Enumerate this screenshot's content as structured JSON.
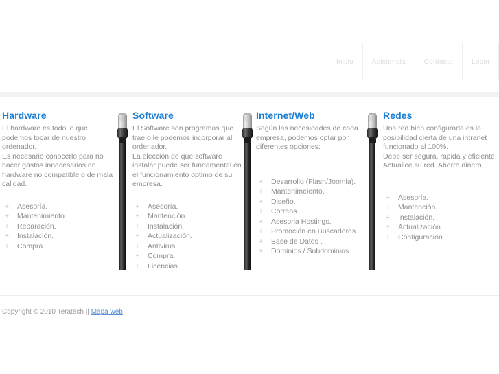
{
  "nav": {
    "items": [
      {
        "label": "Inicio"
      },
      {
        "label": "Asistencia"
      },
      {
        "label": "Contacto"
      },
      {
        "label": "Login"
      }
    ]
  },
  "colors": {
    "heading": "#1a7fd4",
    "body_text": "#8f8f8f",
    "nav_text": "#dcdcdc",
    "link": "#5a8fd6",
    "band": "#f2f2f2"
  },
  "columns": [
    {
      "title": "Hardware",
      "description": "El hardware es todo lo que podemos tocar de nuestro ordenador.\nEs necesario conocerlo para no hacer gastos innecesarios en hardware no compatible o de mala calidad.",
      "items": [
        "Asesoría.",
        "Mantenimiento.",
        "Reparación.",
        "Instalación.",
        "Compra."
      ]
    },
    {
      "title": "Software",
      "description": "El Software son programas que trae o le podemos incorporar al ordenador.\nLa elección de que software instalar puede ser fundamental en el funcionamiento optimo de su empresa.",
      "items": [
        "Asesoría.",
        "Mantención.",
        "Instalación.",
        "Actualización.",
        "Antivirus.",
        "Compra.",
        "Licencias."
      ]
    },
    {
      "title": "Internet/Web",
      "description": "Según las necesidades de cada empresa, podemos optar por diferentes opciones:",
      "items": [
        "Desarrollo (Flash/Joomla).",
        "Mantenimeiento.",
        "Diseño.",
        "Correos.",
        "Asesoria Hostings.",
        "Promoción en Buscadores.",
        "Base de Datos .",
        "Dominios / Subdominios."
      ]
    },
    {
      "title": "Redes",
      "description": "Una red bien configurada es la posibilidad cierta de una intranet funcionado al 100%.\nDebe ser segura, rápida y eficiente. Actualice su red. Ahorre dinero.",
      "items": [
        "Asesoría.",
        "Mantención.",
        "Instalación.",
        "Actualización.",
        "Configuración."
      ]
    }
  ],
  "footer": {
    "copyright": "Copyright © 2010 Teratech ||",
    "link_label": "Mapa web"
  }
}
